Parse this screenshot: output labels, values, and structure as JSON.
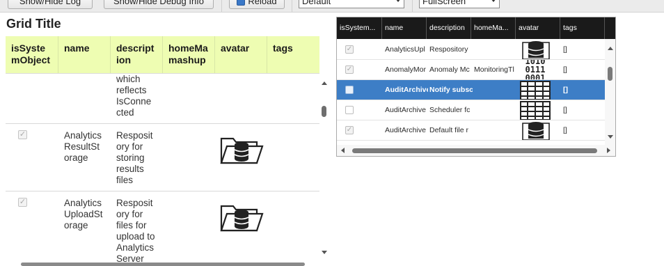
{
  "toolbar": {
    "show_hide_log": "Show/Hide Log",
    "show_hide_debug": "Show/Hide Debug Info",
    "reload": "Reload",
    "theme_select": "Default",
    "mode_select": "FullScreen"
  },
  "grid_title": "Grid Title",
  "left_grid": {
    "columns": [
      "isSyste\nmObject",
      "name",
      "descript\nion",
      "homeMa\nmashup",
      "avatar",
      "tags"
    ],
    "rows": [
      {
        "checked": null,
        "name": "",
        "description": "which\nreflects\nIsConne\ncted",
        "avatar": ""
      },
      {
        "checked": true,
        "name": "Analytics\nResultSt\norage",
        "description": "Resposit\nory for\nstoring\nresults\nfiles",
        "avatar": "folder-database-icon"
      },
      {
        "checked": true,
        "name": "Analytics\nUploadSt\norage",
        "description": "Resposit\nory for\nfiles for\nupload to\nAnalytics\nServer",
        "avatar": "folder-database-icon"
      }
    ]
  },
  "right_grid": {
    "columns": [
      "isSystem...",
      "name",
      "description",
      "homeMa...",
      "avatar",
      "tags"
    ],
    "rows": [
      {
        "checked": true,
        "name": "AnalyticsUpl",
        "description": "Respository",
        "homeMashup": "",
        "avatar": "database-icon",
        "tags": "[]",
        "selected": false
      },
      {
        "checked": true,
        "name": "AnomalyMor",
        "description": "Anomaly Mc",
        "homeMashup": "MonitoringTl",
        "avatar": "binary-icon",
        "tags": "[]",
        "selected": false
      },
      {
        "checked": false,
        "name": "AuditArchive",
        "description": "Notify subsc",
        "homeMashup": "",
        "avatar": "grid-icon",
        "tags": "[]",
        "selected": true
      },
      {
        "checked": false,
        "name": "AuditArchive",
        "description": "Scheduler fc",
        "homeMashup": "",
        "avatar": "grid-icon",
        "tags": "[]",
        "selected": false
      },
      {
        "checked": true,
        "name": "AuditArchive",
        "description": "Default file r",
        "homeMashup": "",
        "avatar": "database-icon",
        "tags": "[]",
        "selected": false
      }
    ]
  },
  "colors": {
    "header_bg": "#eefdb2",
    "dark_header_bg": "#1a1a1a",
    "selected_row": "#3d7ec6"
  }
}
